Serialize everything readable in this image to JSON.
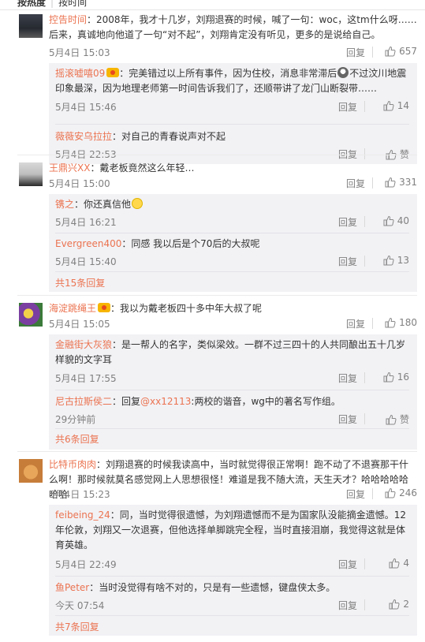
{
  "sort_bar": {
    "hot": "按热度",
    "time": "按时间"
  },
  "threads": [
    {
      "user": "控告时间",
      "text": "：2008年，我才十几岁，刘翔退赛的时候，喊了一句：woc，这tm什么呀……后来，真诚地向他道了一句“对不起”，刘翔肯定没有听见，更多的是说给自己。",
      "time": "5月4日 15:03",
      "reply": "回复",
      "likes": "657",
      "subs": [
        {
          "user": "摇滚嘘嘻09",
          "text": "：完美错过以上所有事件，因为住校，消息非常滞后",
          "text2": "不过汶川地震印象最深，因为地理老师第一时间告诉我们了，还顺带讲了龙门山断裂带……",
          "time": "5月4日 15:46",
          "reply": "回复",
          "likes": "14"
        },
        {
          "user": "薇薇安乌拉拉",
          "text": "：对自己的青春说声对不起",
          "time": "5月4日 22:53",
          "reply": "回复",
          "likes": "赞"
        }
      ]
    },
    {
      "user": "王鼎兴XX",
      "text": "：戴老板竟然这么年轻…",
      "time": "5月4日 15:00",
      "reply": "回复",
      "likes": "331",
      "subs": [
        {
          "user": "镌之",
          "text": "：你还真信他",
          "time": "5月4日 16:21",
          "reply": "回复",
          "likes": "40"
        },
        {
          "user": "Evergreen400",
          "text": "：同感 我以后是个70后的大叔呢",
          "time": "5月4日 15:40",
          "reply": "回复",
          "likes": "13"
        }
      ],
      "more": "共15条回复"
    },
    {
      "user": "海淀跳绳王",
      "text": "：我以为戴老板四十多中年大叔了呢",
      "time": "5月4日 15:05",
      "reply": "回复",
      "likes": "180",
      "subs": [
        {
          "user": "金融街大灰狼",
          "text": "：是一帮人的名字，类似梁效。一群不过三四十的人共同酿出五十几岁样貌的文字耳",
          "time": "5月4日 17:55",
          "reply": "回复",
          "likes": "16"
        },
        {
          "user": "尼古拉斯侯二",
          "text": "：回复",
          "mention": "@xx12113",
          "text2": ":两校的谐音，wg中的著名写作组。",
          "time": "29分钟前",
          "reply": "回复",
          "likes": "赞"
        }
      ],
      "more": "共6条回复"
    },
    {
      "user": "比特币肉肉",
      "text": "：刘翔退赛的时候我读高中，当时就觉得很正常啊！跑不动了不退赛那干什么啊！那时候就莫名感觉网上人思想很怪！难道是我不随大流，天生天才？哈哈哈哈哈哈哈",
      "time": "5月4日 15:23",
      "reply": "回复",
      "likes": "246",
      "subs": [
        {
          "user": "feibeing_24",
          "text": "：同，当时觉得很遗憾，为刘翔遗憾而不是为国家队没能摘金遗憾。12年伦敦，刘翔又一次退赛，但他选择单脚跳完全程，当时直接泪崩，我觉得这就是体育英雄。",
          "time": "5月4日 22:49",
          "reply": "回复",
          "likes": "4"
        },
        {
          "user": "鱼Peter",
          "text": "：当时没觉得有啥不对的，只是有一些遗憾，键盘侠太多。",
          "time": "今天 07:54",
          "reply": "回复",
          "likes": "2"
        }
      ],
      "more": "共7条回复"
    }
  ],
  "colors": {
    "username": "#eb7350",
    "meta": "#808080",
    "subbox_bg": "#f2f2f5"
  }
}
